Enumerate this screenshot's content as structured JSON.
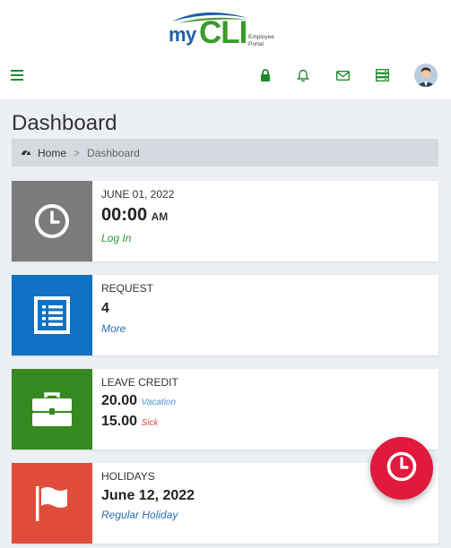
{
  "brand": {
    "my": "my",
    "cli": "CLI",
    "sub_line1": "Employee",
    "sub_line2": "Portal"
  },
  "nav_icons": [
    "hamburger-menu-icon",
    "lock-icon",
    "bell-icon",
    "mail-icon",
    "server-icon",
    "user-avatar"
  ],
  "page": {
    "title": "Dashboard"
  },
  "breadcrumb": {
    "home": "Home",
    "separator": ">",
    "current": "Dashboard"
  },
  "cards": {
    "time": {
      "date": "JUNE 01, 2022",
      "time": "00:00",
      "ampm": "AM",
      "action": "Log In",
      "color": "#7b7b7b",
      "action_color": "#2b9a3c"
    },
    "request": {
      "label": "REQUEST",
      "value": "4",
      "action": "More",
      "color": "#1172c3",
      "action_color": "#2a6fb3"
    },
    "leave": {
      "label": "LEAVE CREDIT",
      "vacation_value": "20.00",
      "vacation_label": "Vacation",
      "sick_value": "15.00",
      "sick_label": "Sick",
      "color": "#368920",
      "vacation_color": "#4a90d9",
      "sick_color": "#d9534f"
    },
    "holidays": {
      "label": "HOLIDAYS",
      "value": "June 12, 2022",
      "action": "Regular Holiday",
      "color": "#e04c3b",
      "action_color": "#2a6fb3"
    }
  },
  "colors": {
    "nav_green": "#198c2e",
    "fab_red": "#e0193d"
  }
}
